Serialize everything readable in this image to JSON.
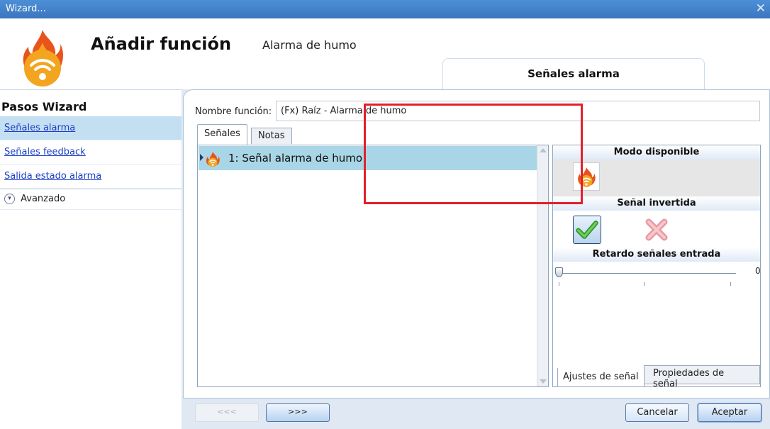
{
  "window": {
    "title": "Wizard...",
    "close_glyph": "✕"
  },
  "header": {
    "title": "Añadir función",
    "subtitle": "Alarma de humo",
    "icon": "flame-wifi-icon"
  },
  "step_tab": {
    "label": "Señales alarma"
  },
  "sidebar": {
    "title": "Pasos Wizard",
    "items": [
      {
        "label": "Señales alarma",
        "active": true
      },
      {
        "label": "Señales feedback",
        "active": false
      },
      {
        "label": "Salida estado alarma",
        "active": false
      }
    ],
    "advanced": {
      "label": "Avanzado",
      "icon": "chevron-down-circle-icon"
    }
  },
  "form": {
    "name_label": "Nombre función:",
    "name_value": "(Fx) Raíz - Alarma de humo"
  },
  "tabs": {
    "signals": "Señales",
    "notes": "Notas"
  },
  "signals_list": [
    {
      "label": "1: Señal alarma de humo",
      "selected": true
    }
  ],
  "right_panel": {
    "mode_header": "Modo disponible",
    "inverted_header": "Señal invertida",
    "delay_header": "Retardo señales entrada",
    "delay_value": "0",
    "inverted": true,
    "tab_settings": "Ajustes de señal",
    "tab_properties": "Propiedades de señal"
  },
  "buttons": {
    "prev": "<<<",
    "next": ">>>",
    "cancel": "Cancelar",
    "accept": "Aceptar"
  },
  "colors": {
    "titlebar": "#3a76bf",
    "highlight": "#e3202a",
    "selection": "#a9d6e6",
    "link": "#1a3fc4"
  }
}
